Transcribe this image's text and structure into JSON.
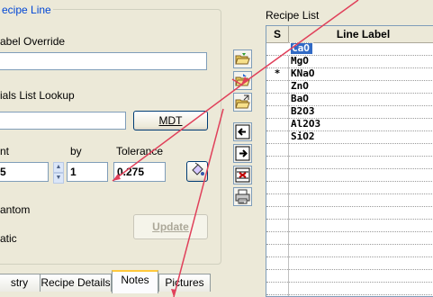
{
  "left_panel": {
    "group_title": "ecipe Line",
    "label_override_label": "abel Override",
    "label_override_value": "",
    "materials_lookup_label": "ials List Lookup",
    "materials_lookup_value": "",
    "mdt_button": "MDT",
    "amount_label": "nt",
    "by_label": "by",
    "tolerance_label": "Tolerance",
    "amount_value": "5",
    "by_value": "1",
    "tolerance_value": "0.275",
    "phantom_label": "antom",
    "static_label": "atic",
    "update_button": "Update"
  },
  "tabs": [
    {
      "label": "stry"
    },
    {
      "label": "Recipe Details"
    },
    {
      "label": "Notes",
      "active": true
    },
    {
      "label": "Pictures"
    }
  ],
  "toolbar": {
    "icons": [
      "open-folder-icon",
      "open-folder-alt-icon",
      "open-folder-arrows-icon",
      "arrow-left-icon",
      "arrow-right-icon",
      "delete-x-icon",
      "print-icon"
    ]
  },
  "recipe_list": {
    "title": "Recipe List",
    "col_s": "S",
    "col_label": "Line Label",
    "rows": [
      {
        "s": "",
        "label": "CaO",
        "selected": true
      },
      {
        "s": "",
        "label": "MgO"
      },
      {
        "s": "*",
        "label": "KNaO"
      },
      {
        "s": "",
        "label": "ZnO"
      },
      {
        "s": "",
        "label": "BaO"
      },
      {
        "s": "",
        "label": "B2O3"
      },
      {
        "s": "",
        "label": "Al2O3"
      },
      {
        "s": "",
        "label": "SiO2"
      },
      {
        "s": "",
        "label": ""
      },
      {
        "s": "",
        "label": ""
      },
      {
        "s": "",
        "label": ""
      },
      {
        "s": "",
        "label": ""
      },
      {
        "s": "",
        "label": ""
      },
      {
        "s": "",
        "label": ""
      },
      {
        "s": "",
        "label": ""
      },
      {
        "s": "",
        "label": ""
      },
      {
        "s": "",
        "label": ""
      },
      {
        "s": "",
        "label": ""
      },
      {
        "s": "",
        "label": ""
      },
      {
        "s": "",
        "label": ""
      }
    ]
  },
  "colors": {
    "accent": "#316ac5",
    "group_title": "#0046d5",
    "annotation_arrow": "#e0405a"
  }
}
